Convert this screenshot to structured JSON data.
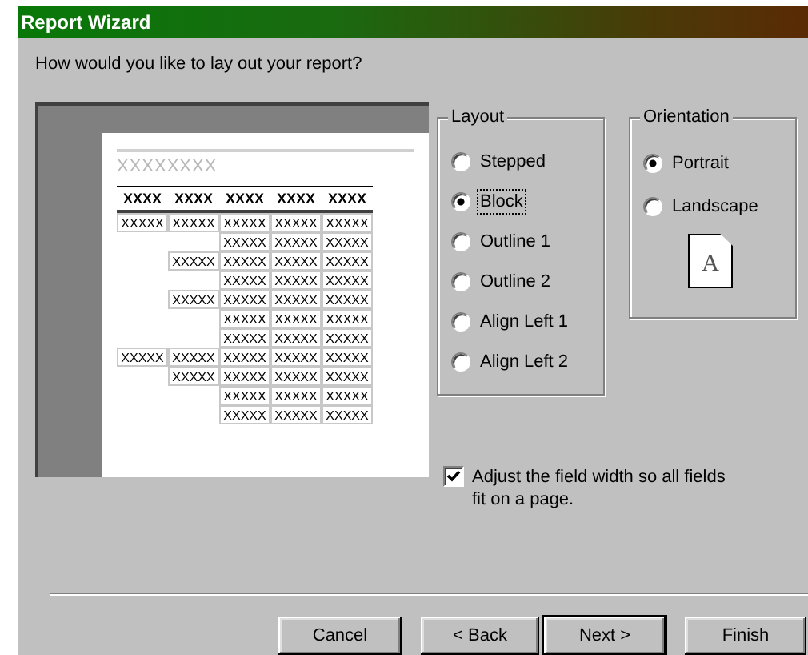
{
  "window": {
    "title": "Report Wizard"
  },
  "prompt": "How would you like to lay out your report?",
  "preview": {
    "title": "XXXXXXXX",
    "headers": [
      "XXXX",
      "XXXX",
      "XXXX",
      "XXXX",
      "XXXX"
    ],
    "rows": [
      [
        "XXXXX",
        "XXXXX",
        "XXXXX",
        "XXXXX",
        "XXXXX"
      ],
      [
        null,
        null,
        "XXXXX",
        "XXXXX",
        "XXXXX"
      ],
      [
        null,
        "XXXXX",
        "XXXXX",
        "XXXXX",
        "XXXXX"
      ],
      [
        null,
        null,
        "XXXXX",
        "XXXXX",
        "XXXXX"
      ],
      [
        null,
        "XXXXX",
        "XXXXX",
        "XXXXX",
        "XXXXX"
      ],
      [
        null,
        null,
        "XXXXX",
        "XXXXX",
        "XXXXX"
      ],
      [
        null,
        null,
        "XXXXX",
        "XXXXX",
        "XXXXX"
      ],
      [
        "XXXXX",
        "XXXXX",
        "XXXXX",
        "XXXXX",
        "XXXXX"
      ],
      [
        null,
        "XXXXX",
        "XXXXX",
        "XXXXX",
        "XXXXX"
      ],
      [
        null,
        null,
        "XXXXX",
        "XXXXX",
        "XXXXX"
      ],
      [
        null,
        null,
        "XXXXX",
        "XXXXX",
        "XXXXX"
      ]
    ]
  },
  "layout": {
    "label": "Layout",
    "options": [
      {
        "label": "Stepped",
        "selected": false,
        "focused": false
      },
      {
        "label": "Block",
        "selected": true,
        "focused": true
      },
      {
        "label": "Outline 1",
        "selected": false,
        "focused": false
      },
      {
        "label": "Outline 2",
        "selected": false,
        "focused": false
      },
      {
        "label": "Align Left 1",
        "selected": false,
        "focused": false
      },
      {
        "label": "Align Left 2",
        "selected": false,
        "focused": false
      }
    ]
  },
  "orientation": {
    "label": "Orientation",
    "options": [
      {
        "label": "Portrait",
        "selected": true,
        "focused": false
      },
      {
        "label": "Landscape",
        "selected": false,
        "focused": false
      }
    ],
    "page_letter": "A"
  },
  "adjust_width": {
    "label": "Adjust the field width so all fields fit on a page.",
    "checked": true
  },
  "buttons": [
    {
      "label": "Cancel",
      "default": false
    },
    {
      "label": "< Back",
      "default": false
    },
    {
      "label": "Next >",
      "default": true
    },
    {
      "label": "Finish",
      "default": false
    }
  ]
}
